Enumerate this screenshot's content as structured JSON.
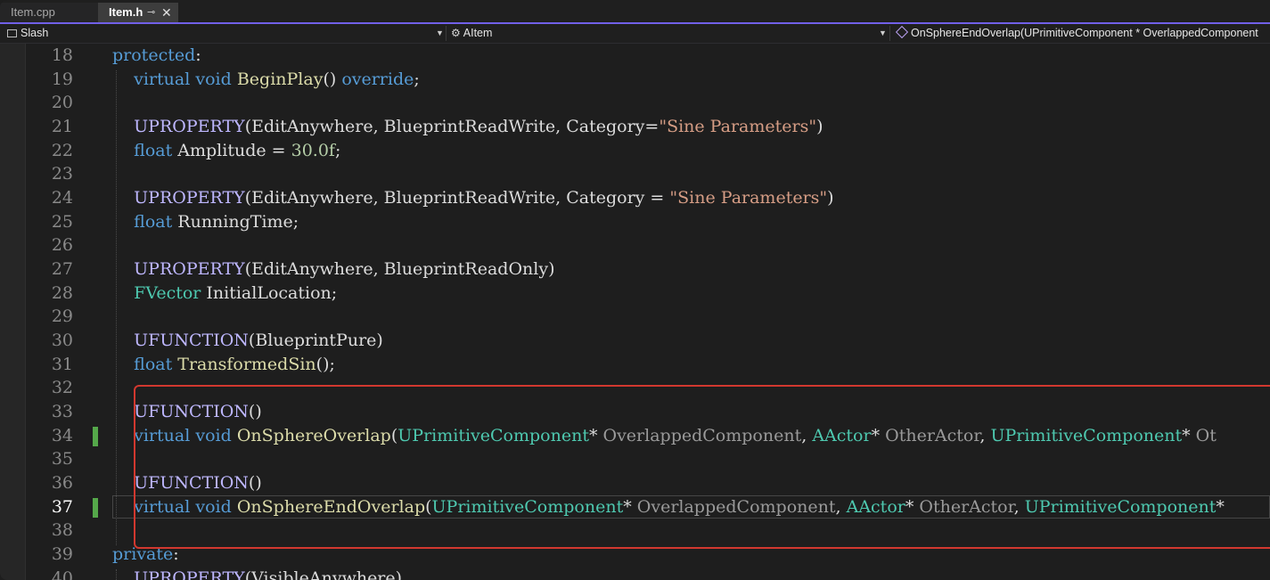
{
  "tabs": [
    {
      "label": "Item.cpp",
      "active": false
    },
    {
      "label": "Item.h",
      "active": true
    }
  ],
  "nav": {
    "project": "Slash",
    "scope": "AItem",
    "member": "OnSphereEndOverlap(UPrimitiveComponent * OverlappedComponent"
  },
  "colors": {
    "accent": "#7160e8",
    "keyword": "#569cd6",
    "macro": "#beb7ff",
    "function": "#dcdcaa",
    "type": "#4ec9b0",
    "string": "#d69d85",
    "number": "#b5cea8",
    "highlight_box": "#d2382f",
    "change_marker": "#55a84a"
  },
  "editor": {
    "current_line": 37,
    "changed_lines": [
      34,
      37
    ],
    "lines": [
      {
        "num": "18",
        "tokens": [
          {
            "t": "protected",
            "c": "kw"
          },
          {
            "t": ":",
            "c": "pl"
          }
        ]
      },
      {
        "num": "19",
        "tokens": [
          {
            "t": "    virtual void ",
            "c": "kw"
          },
          {
            "t": "BeginPlay",
            "c": "fn"
          },
          {
            "t": "() ",
            "c": "pl"
          },
          {
            "t": "override",
            "c": "kw"
          },
          {
            "t": ";",
            "c": "pl"
          }
        ]
      },
      {
        "num": "20",
        "tokens": []
      },
      {
        "num": "21",
        "tokens": [
          {
            "t": "    UPROPERTY",
            "c": "macro"
          },
          {
            "t": "(EditAnywhere, BlueprintReadWrite, Category=",
            "c": "pl"
          },
          {
            "t": "\"Sine Parameters\"",
            "c": "str"
          },
          {
            "t": ")",
            "c": "pl"
          }
        ]
      },
      {
        "num": "22",
        "tokens": [
          {
            "t": "    float ",
            "c": "kw"
          },
          {
            "t": "Amplitude = ",
            "c": "pl"
          },
          {
            "t": "30.0f",
            "c": "num"
          },
          {
            "t": ";",
            "c": "pl"
          }
        ]
      },
      {
        "num": "23",
        "tokens": []
      },
      {
        "num": "24",
        "tokens": [
          {
            "t": "    UPROPERTY",
            "c": "macro"
          },
          {
            "t": "(EditAnywhere, BlueprintReadWrite, Category = ",
            "c": "pl"
          },
          {
            "t": "\"Sine Parameters\"",
            "c": "str"
          },
          {
            "t": ")",
            "c": "pl"
          }
        ]
      },
      {
        "num": "25",
        "tokens": [
          {
            "t": "    float ",
            "c": "kw"
          },
          {
            "t": "RunningTime;",
            "c": "pl"
          }
        ]
      },
      {
        "num": "26",
        "tokens": []
      },
      {
        "num": "27",
        "tokens": [
          {
            "t": "    UPROPERTY",
            "c": "macro"
          },
          {
            "t": "(EditAnywhere, BlueprintReadOnly)",
            "c": "pl"
          }
        ]
      },
      {
        "num": "28",
        "tokens": [
          {
            "t": "    FVector ",
            "c": "ty"
          },
          {
            "t": "InitialLocation;",
            "c": "pl"
          }
        ]
      },
      {
        "num": "29",
        "tokens": []
      },
      {
        "num": "30",
        "tokens": [
          {
            "t": "    UFUNCTION",
            "c": "macro"
          },
          {
            "t": "(BlueprintPure)",
            "c": "pl"
          }
        ]
      },
      {
        "num": "31",
        "tokens": [
          {
            "t": "    float ",
            "c": "kw"
          },
          {
            "t": "TransformedSin",
            "c": "fn"
          },
          {
            "t": "();",
            "c": "pl"
          }
        ]
      },
      {
        "num": "32",
        "tokens": []
      },
      {
        "num": "33",
        "tokens": [
          {
            "t": "    UFUNCTION",
            "c": "macro"
          },
          {
            "t": "()",
            "c": "pl"
          }
        ]
      },
      {
        "num": "34",
        "tokens": [
          {
            "t": "    virtual void ",
            "c": "kw"
          },
          {
            "t": "OnSphereOverlap",
            "c": "fn"
          },
          {
            "t": "(",
            "c": "pl"
          },
          {
            "t": "UPrimitiveComponent",
            "c": "ty"
          },
          {
            "t": "* ",
            "c": "pl"
          },
          {
            "t": "OverlappedComponent",
            "c": "param"
          },
          {
            "t": ", ",
            "c": "pl"
          },
          {
            "t": "AActor",
            "c": "ty"
          },
          {
            "t": "* ",
            "c": "pl"
          },
          {
            "t": "OtherActor",
            "c": "param"
          },
          {
            "t": ", ",
            "c": "pl"
          },
          {
            "t": "UPrimitiveComponent",
            "c": "ty"
          },
          {
            "t": "* ",
            "c": "pl"
          },
          {
            "t": "Ot",
            "c": "param"
          }
        ]
      },
      {
        "num": "35",
        "tokens": []
      },
      {
        "num": "36",
        "tokens": [
          {
            "t": "    UFUNCTION",
            "c": "macro"
          },
          {
            "t": "()",
            "c": "pl"
          }
        ]
      },
      {
        "num": "37",
        "tokens": [
          {
            "t": "    virtual void ",
            "c": "kw"
          },
          {
            "t": "OnSphereEndOverlap",
            "c": "fn"
          },
          {
            "t": "(",
            "c": "pl"
          },
          {
            "t": "UPrimitiveComponent",
            "c": "ty"
          },
          {
            "t": "* ",
            "c": "pl"
          },
          {
            "t": "OverlappedComponent",
            "c": "param"
          },
          {
            "t": ", ",
            "c": "pl"
          },
          {
            "t": "AActor",
            "c": "ty"
          },
          {
            "t": "* ",
            "c": "pl"
          },
          {
            "t": "OtherActor",
            "c": "param"
          },
          {
            "t": ", ",
            "c": "pl"
          },
          {
            "t": "UPrimitiveComponent",
            "c": "ty"
          },
          {
            "t": "*",
            "c": "pl"
          }
        ]
      },
      {
        "num": "38",
        "tokens": []
      },
      {
        "num": "39",
        "tokens": [
          {
            "t": "private",
            "c": "kw"
          },
          {
            "t": ":",
            "c": "pl"
          }
        ]
      },
      {
        "num": "40",
        "tokens": [
          {
            "t": "    UPROPERTY",
            "c": "macro"
          },
          {
            "t": "(VisibleAnywhere)",
            "c": "pl"
          }
        ]
      }
    ]
  }
}
